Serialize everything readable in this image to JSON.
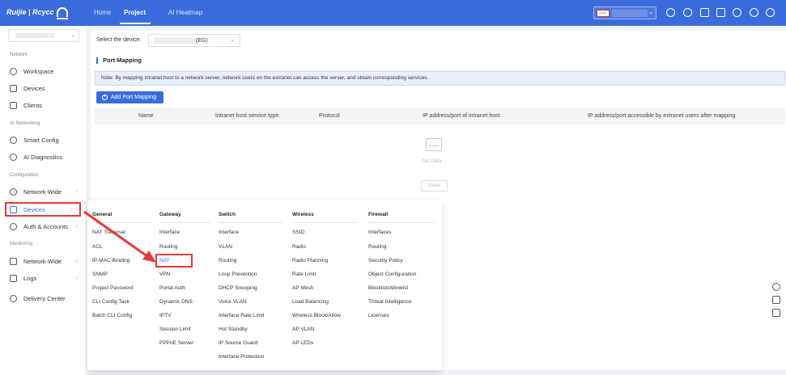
{
  "brand": {
    "logo_text": "Ruijie | Rcycc"
  },
  "topnav": {
    "items": [
      "Home",
      "Project",
      "AI Heatmap"
    ],
    "active": "Project"
  },
  "account": {
    "badge": "LOGO"
  },
  "sidebar": {
    "sections": {
      "network": "Network",
      "ai_networking": "AI Networking",
      "configuration": "Configuration",
      "monitoring": "Monitoring"
    },
    "items": {
      "workspace": "Workspace",
      "devices": "Devices",
      "clients": "Clients",
      "smart_config": "Smart Config",
      "ai_diagnostics": "AI Diagnostics",
      "network_wide": "Network-Wide",
      "devices_config": "Devices",
      "auth_accounts": "Auth & Accounts",
      "network_wide_mon": "Network-Wide",
      "logs": "Logs",
      "delivery_center": "Delivery Center"
    }
  },
  "main": {
    "device_label": "Select the device:",
    "device_value": "(EG)",
    "section_title": "Port Mapping",
    "note": "Note: By mapping intranet host to a network server, network users on the extranet can access the server, and obtain corresponding services.",
    "add_button": "Add Port Mapping",
    "columns": [
      "Name",
      "Intranet host service type",
      "Protocol",
      "IP address/port of intranet host",
      "IP address/port accessible by extranet users after mapping"
    ],
    "no_data": "No Data",
    "save_button": "Save"
  },
  "menu": {
    "general": {
      "title": "General",
      "items": [
        "NAT Traversal",
        "ACL",
        "IP-MAC Binding",
        "SNMP",
        "Project Password",
        "CLI Config Task",
        "Batch CLI Config"
      ]
    },
    "gateway": {
      "title": "Gateway",
      "items": [
        "Interface",
        "Routing",
        "NAT",
        "VPN",
        "Portal Auth",
        "Dynamic DNS",
        "IPTV",
        "Session Limit",
        "PPPoE Server"
      ]
    },
    "switch": {
      "title": "Switch",
      "items": [
        "Interface",
        "VLAN",
        "Routing",
        "Loop Prevention",
        "DHCP Snooping",
        "Voice VLAN",
        "Interface Rate Limit",
        "Hot Standby",
        "IP Source Guard",
        "Interface Protection"
      ]
    },
    "wireless": {
      "title": "Wireless",
      "items": [
        "SSID",
        "Radio",
        "Radio Planning",
        "Rate Limit",
        "AP Mesh",
        "Load Balancing",
        "Wireless Block/Allow",
        "AP VLAN",
        "AP LEDs"
      ]
    },
    "firewall": {
      "title": "Firewall",
      "items": [
        "Interfaces",
        "Routing",
        "Security Policy",
        "Object Configuration",
        "Blocklist/Allowlist",
        "Threat Intelligence",
        "Licenses"
      ]
    }
  },
  "colors": {
    "primary": "#3a6bdc",
    "annotation": "#e03c3c"
  }
}
